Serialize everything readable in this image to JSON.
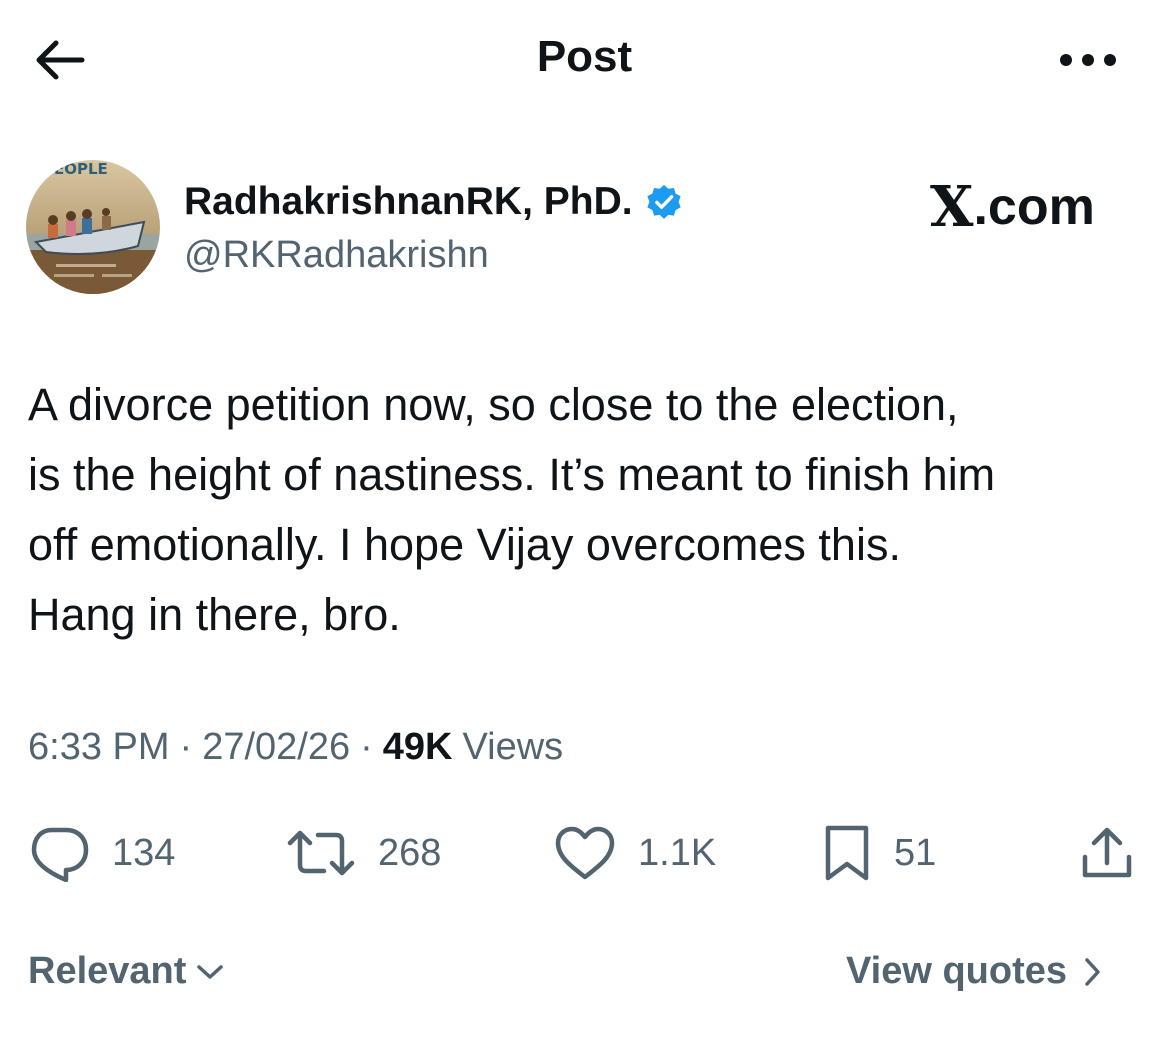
{
  "header": {
    "title": "Post",
    "back_icon": "arrow-left-icon",
    "more_icon": "ellipsis-icon"
  },
  "author": {
    "name": "RadhakrishnanRK, PhD.",
    "handle": "@RKRadhakrishn",
    "verified": true,
    "verified_color": "#1d9bf0",
    "avatar_text": "EOPLE"
  },
  "watermark": {
    "text": ".com",
    "logo": "X"
  },
  "post": {
    "lines": [
      "A divorce petition now, so close to the election,",
      "is the height of nastiness. It’s meant to finish him",
      "off emotionally. I hope Vijay overcomes this.",
      "Hang in there, bro."
    ]
  },
  "meta": {
    "time": "6:33 PM",
    "separator": "·",
    "date": "27/02/26",
    "views_count": "49K",
    "views_label": "Views"
  },
  "actions": {
    "replies": "134",
    "reposts": "268",
    "likes": "1.1K",
    "bookmarks": "51"
  },
  "footer": {
    "sort_label": "Relevant",
    "view_quotes_label": "View quotes"
  },
  "colors": {
    "text_primary": "#0f1419",
    "text_secondary": "#536471",
    "accent": "#1d9bf0"
  }
}
